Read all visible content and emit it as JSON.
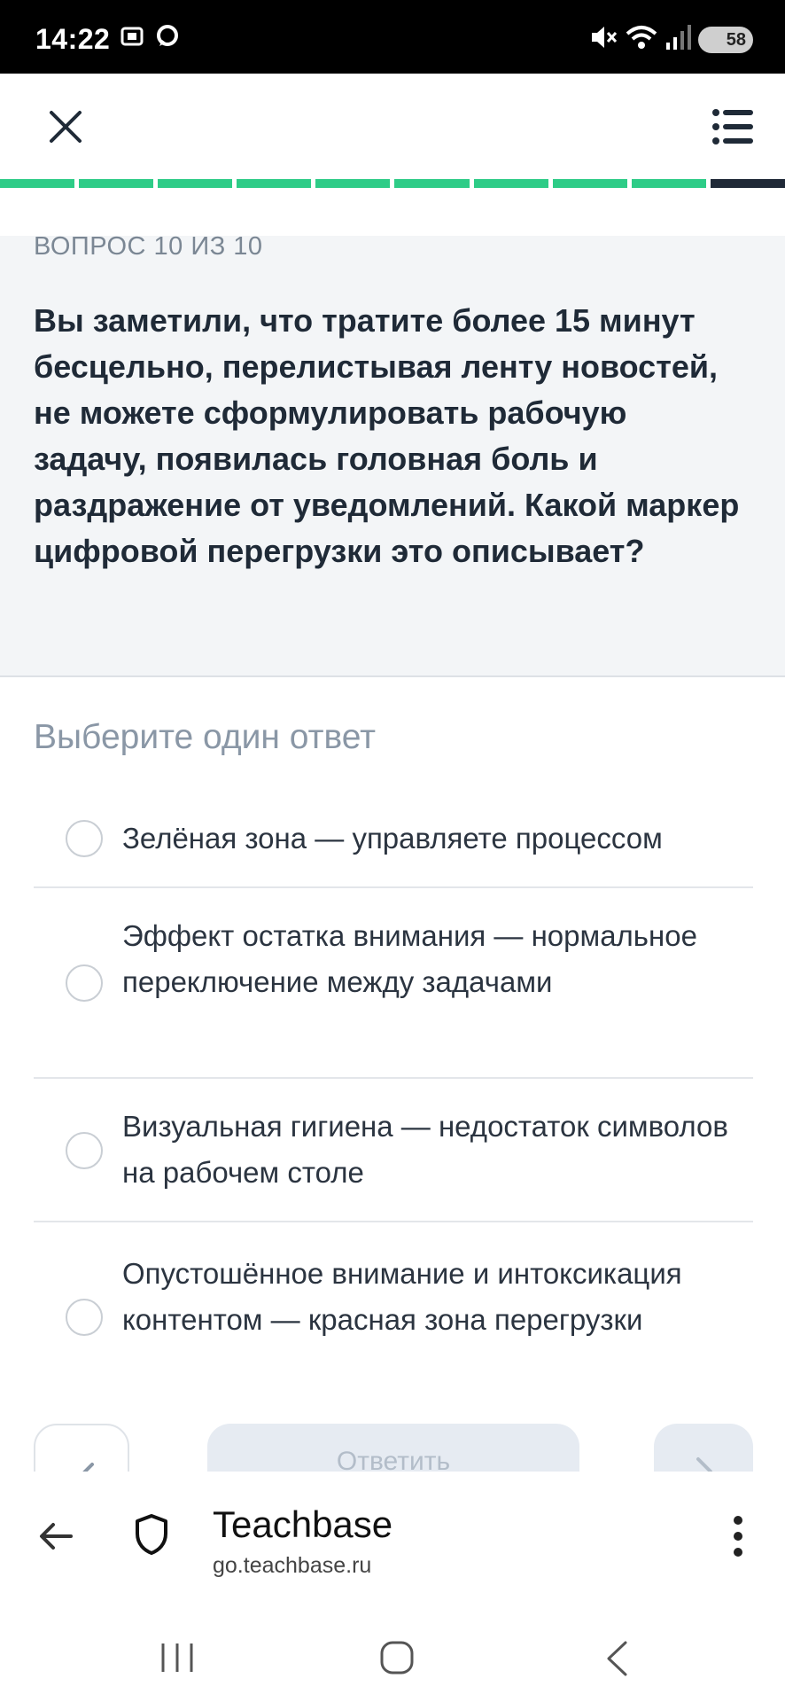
{
  "status_bar": {
    "time": "14:22",
    "battery": "58",
    "icons": [
      "screenshot-icon",
      "chat-icon",
      "mute-icon",
      "wifi-icon",
      "signal-icon",
      "battery-icon"
    ]
  },
  "header": {
    "close_icon": "close-icon",
    "menu_icon": "list-menu-icon"
  },
  "progress": {
    "total": 10,
    "current": 10,
    "completed_color": "#2ecc87",
    "current_color": "#1f2937"
  },
  "question": {
    "counter": "ВОПРОС 10 ИЗ 10",
    "text": "Вы заметили, что тратите более 15 минут бесцельно, перелистывая ленту новостей, не можете сформулировать рабочую задачу, появилась головная боль и раздражение от уведомлений. Какой маркер цифровой перегрузки это описывает?"
  },
  "answers": {
    "label": "Выберите один ответ",
    "options": [
      "Зелёная зона — управляете процессом",
      "Эффект остатка внимания — нормальное переключение между задачами",
      "Визуальная гигиена — недостаток символов на рабочем столе",
      "Опустошённое внимание и интоксикация контентом — красная зона перегрузки"
    ]
  },
  "actions": {
    "answer_label": "Ответить"
  },
  "browser": {
    "title": "Teachbase",
    "url": "go.teachbase.ru"
  }
}
